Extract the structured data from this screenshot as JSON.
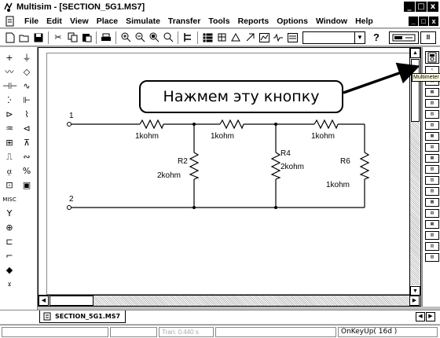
{
  "window": {
    "title": "Multisim - [SECTION_5G1.MS7]",
    "minimize": "_",
    "maximize": "□",
    "close": "x"
  },
  "menu": {
    "items": [
      "File",
      "Edit",
      "View",
      "Place",
      "Simulate",
      "Transfer",
      "Tools",
      "Reports",
      "Options",
      "Window",
      "Help"
    ],
    "mdi_minimize": "_",
    "mdi_restore": "□",
    "mdi_close": "x"
  },
  "toolbar": {
    "help_label": "?",
    "pause_label": "II",
    "combo_value": ""
  },
  "circuit": {
    "node_labels": [
      "1",
      "2"
    ],
    "resistors": [
      {
        "name": "",
        "value": "1kohm"
      },
      {
        "name": "R2",
        "value": "2kohm"
      },
      {
        "name": "",
        "value": "1kohm"
      },
      {
        "name": "R4",
        "value": "2kohm"
      },
      {
        "name": "",
        "value": "1kohm"
      },
      {
        "name": "R6",
        "value": "1kohm"
      }
    ]
  },
  "annotation": {
    "callout_text": "Нажмем эту кнопку",
    "tooltip": "Multimeter"
  },
  "tabs": {
    "active_document": "SECTION_5G1.MS7"
  },
  "status": {
    "tran_label": "Tran: 0.440 s",
    "key_event": "OnKeyUp( 16d )"
  },
  "colors": {
    "background": "#c0c0c0",
    "canvas": "#ffffff",
    "callout_border": "#000000"
  },
  "icons": [
    "multisim-app-icon",
    "document-icon",
    "new-icon",
    "open-icon",
    "save-icon",
    "cut-icon",
    "copy-icon",
    "paste-icon",
    "print-icon",
    "zoom-icons",
    "multimeter-icon",
    "arrow-icon"
  ]
}
